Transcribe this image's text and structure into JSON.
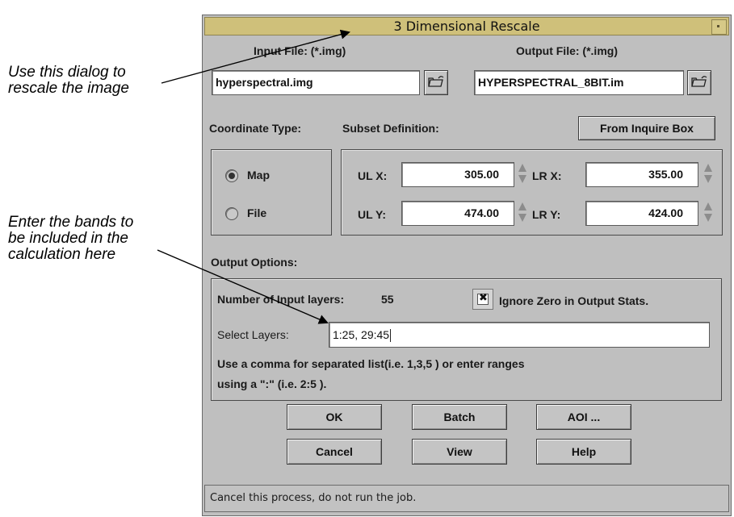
{
  "annotations": {
    "dialog_note": "Use this dialog to\nrescale the image",
    "bands_note": "Enter the bands to\nbe included in the\ncalculation here"
  },
  "dialog": {
    "title": "3 Dimensional Rescale",
    "input_file_label": "Input File: (*.img)",
    "output_file_label": "Output File: (*.img)",
    "input_file_value": "hyperspectral.img",
    "output_file_value": "HYPERSPECTRAL_8BIT.im",
    "coordinate_type_label": "Coordinate Type:",
    "subset_definition_label": "Subset Definition:",
    "from_inquire_box_button": "From Inquire Box",
    "coord_options": {
      "map": "Map",
      "file": "File",
      "selected": "Map"
    },
    "subset": {
      "ulx_label": "UL X:",
      "ulx_value": "305.00",
      "uly_label": "UL Y:",
      "uly_value": "474.00",
      "lrx_label": "LR X:",
      "lrx_value": "355.00",
      "lry_label": "LR Y:",
      "lry_value": "424.00"
    },
    "output_options_label": "Output Options:",
    "num_input_layers_label": "Number of Input layers:",
    "num_input_layers_value": "55",
    "ignore_zero_label": "Ignore Zero in Output Stats.",
    "ignore_zero_checked": true,
    "select_layers_label": "Select Layers:",
    "select_layers_value": "1:25, 29:45",
    "help_text_line1": "Use a comma for separated list(i.e. 1,3,5 ) or enter ranges",
    "help_text_line2": "using a \":\" (i.e. 2:5 ).",
    "buttons": {
      "ok": "OK",
      "batch": "Batch",
      "aoi": "AOI ...",
      "cancel": "Cancel",
      "view": "View",
      "help": "Help"
    },
    "status_text": "Cancel this process, do not run the job."
  },
  "icons": {
    "file_browse": "folder-open-icon",
    "title_menu": "window-menu-icon"
  },
  "colors": {
    "titlebar": "#cfc07a",
    "dialog_bg": "#bfbfbf"
  }
}
